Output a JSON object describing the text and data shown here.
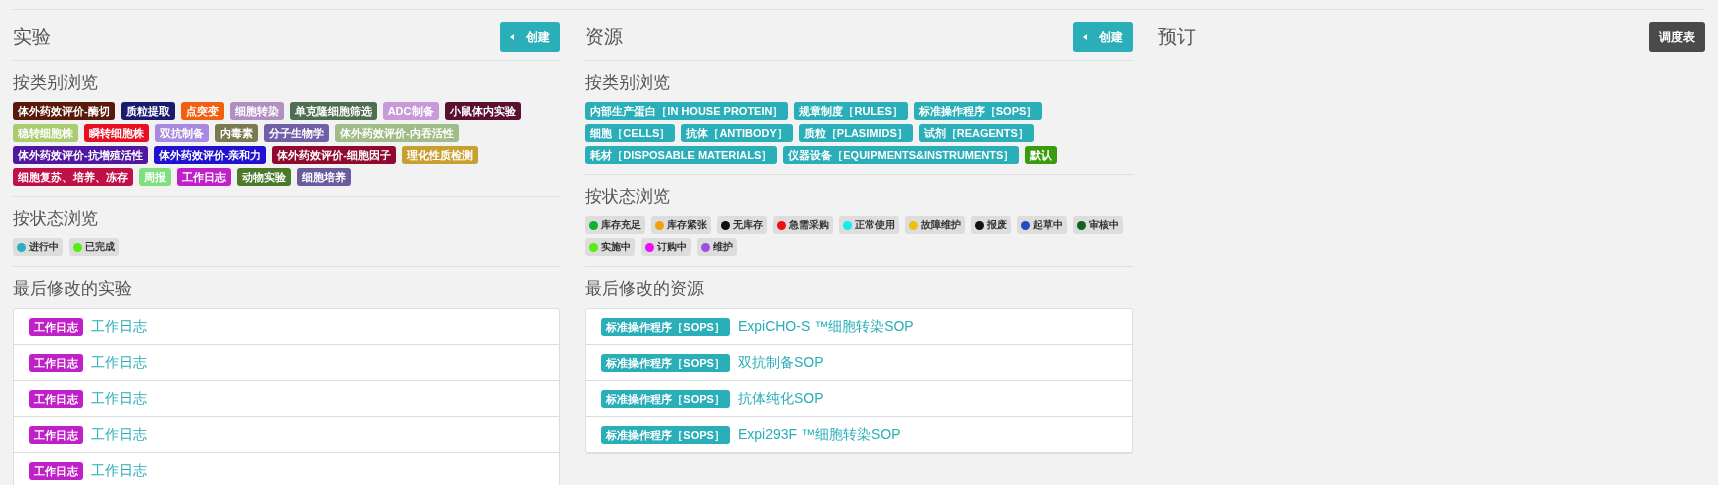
{
  "experiments": {
    "title": "实验",
    "create_button": "创建",
    "browse_by_category": {
      "heading": "按类别浏览",
      "tags": [
        {
          "label": "体外药效评价-酶切",
          "color": "#5a1a0a"
        },
        {
          "label": "质粒提取",
          "color": "#1a1a6e"
        },
        {
          "label": "点突变",
          "color": "#f06010"
        },
        {
          "label": "细胞转染",
          "color": "#b090c0"
        },
        {
          "label": "单克隆细胞筛选",
          "color": "#4e6e50"
        },
        {
          "label": "ADC制备",
          "color": "#c89ad8"
        },
        {
          "label": "小鼠体内实验",
          "color": "#5a1030"
        },
        {
          "label": "稳转细胞株",
          "color": "#a8cc70"
        },
        {
          "label": "瞬转细胞株",
          "color": "#e81020"
        },
        {
          "label": "双抗制备",
          "color": "#a88ae0"
        },
        {
          "label": "内毒素",
          "color": "#7a7a50"
        },
        {
          "label": "分子生物学",
          "color": "#7060a8"
        },
        {
          "label": "体外药效评价-内吞活性",
          "color": "#a0bc88"
        },
        {
          "label": "体外药效评价-抗增殖活性",
          "color": "#5018a0"
        },
        {
          "label": "体外药效评价-亲和力",
          "color": "#2010d0"
        },
        {
          "label": "体外药效评价-细胞因子",
          "color": "#900a30"
        },
        {
          "label": "理化性质检测",
          "color": "#c8a030"
        },
        {
          "label": "细胞复苏、培养、冻存",
          "color": "#c01048"
        },
        {
          "label": "周报",
          "color": "#80e080"
        },
        {
          "label": "工作日志",
          "color": "#c020c8"
        },
        {
          "label": "动物实验",
          "color": "#4a7a2a"
        },
        {
          "label": "细胞培养",
          "color": "#6a5aa0"
        }
      ]
    },
    "browse_by_status": {
      "heading": "按状态浏览",
      "statuses": [
        {
          "label": "进行中",
          "color": "#2aaec0"
        },
        {
          "label": "已完成",
          "color": "#55ee10"
        }
      ]
    },
    "recent": {
      "heading": "最后修改的实验",
      "rows": [
        {
          "tag": {
            "label": "工作日志",
            "color": "#c020c8"
          },
          "title": "工作日志"
        },
        {
          "tag": {
            "label": "工作日志",
            "color": "#c020c8"
          },
          "title": "工作日志"
        },
        {
          "tag": {
            "label": "工作日志",
            "color": "#c020c8"
          },
          "title": "工作日志"
        },
        {
          "tag": {
            "label": "工作日志",
            "color": "#c020c8"
          },
          "title": "工作日志"
        },
        {
          "tag": {
            "label": "工作日志",
            "color": "#c020c8"
          },
          "title": "工作日志"
        }
      ]
    }
  },
  "resources": {
    "title": "资源",
    "create_button": "创建",
    "browse_by_category": {
      "heading": "按类别浏览",
      "tags": [
        {
          "label": "内部生产蛋白［IN HOUSE PROTEIN］",
          "color": "#2aaeb8"
        },
        {
          "label": "规章制度［RULES］",
          "color": "#2aaeb8"
        },
        {
          "label": "标准操作程序［SOPS］",
          "color": "#2aaeb8"
        },
        {
          "label": "细胞［CELLS］",
          "color": "#2aaeb8"
        },
        {
          "label": "抗体［ANTIBODY］",
          "color": "#2aaeb8"
        },
        {
          "label": "质粒［PLASIMIDS］",
          "color": "#2aaeb8"
        },
        {
          "label": "试剂［REAGENTS］",
          "color": "#2aaeb8"
        },
        {
          "label": "耗材［DISPOSABLE MATERIALS］",
          "color": "#2aaeb8"
        },
        {
          "label": "仪器设备［EQUIPMENTS&INSTRUMENTS］",
          "color": "#2aaeb8"
        },
        {
          "label": "默认",
          "color": "#3a9a10"
        }
      ]
    },
    "browse_by_status": {
      "heading": "按状态浏览",
      "statuses": [
        {
          "label": "库存充足",
          "color": "#10b030"
        },
        {
          "label": "库存紧张",
          "color": "#f0a010"
        },
        {
          "label": "无库存",
          "color": "#111111"
        },
        {
          "label": "急需采购",
          "color": "#ee1010"
        },
        {
          "label": "正常使用",
          "color": "#10eeee"
        },
        {
          "label": "故障维护",
          "color": "#f0c010"
        },
        {
          "label": "报废",
          "color": "#111111"
        },
        {
          "label": "起草中",
          "color": "#2050c0"
        },
        {
          "label": "审核中",
          "color": "#106020"
        },
        {
          "label": "实施中",
          "color": "#55ee10"
        },
        {
          "label": "订购中",
          "color": "#ee10ee"
        },
        {
          "label": "维护",
          "color": "#a050e0"
        }
      ]
    },
    "recent": {
      "heading": "最后修改的资源",
      "rows": [
        {
          "tag": {
            "label": "标准操作程序［SOPS］",
            "color": "#2aaeb8"
          },
          "title": "ExpiCHO-S ™细胞转染SOP"
        },
        {
          "tag": {
            "label": "标准操作程序［SOPS］",
            "color": "#2aaeb8"
          },
          "title": "双抗制备SOP"
        },
        {
          "tag": {
            "label": "标准操作程序［SOPS］",
            "color": "#2aaeb8"
          },
          "title": "抗体纯化SOP"
        },
        {
          "tag": {
            "label": "标准操作程序［SOPS］",
            "color": "#2aaeb8"
          },
          "title": "Expi293F ™细胞转染SOP"
        }
      ]
    }
  },
  "booking": {
    "title": "预订",
    "schedule_button": "调度表"
  }
}
